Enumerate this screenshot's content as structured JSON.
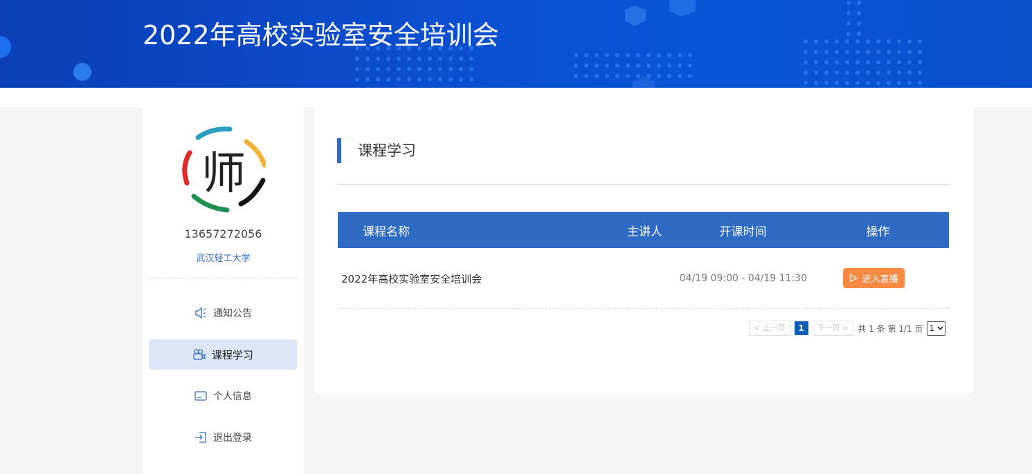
{
  "header": {
    "title": "2022年高校实验室安全培训会",
    "background_color": "#0b4fd0"
  },
  "sidebar": {
    "avatar_glyph": "师",
    "phone": "13657272056",
    "school": "武汉轻工大学",
    "items": [
      {
        "label": "通知公告",
        "icon": "speaker-icon",
        "active": false
      },
      {
        "label": "课程学习",
        "icon": "video-camera-icon",
        "active": true
      },
      {
        "label": "个人信息",
        "icon": "id-card-icon",
        "active": false
      },
      {
        "label": "退出登录",
        "icon": "logout-icon",
        "active": false
      }
    ]
  },
  "main": {
    "section_title": "课程学习",
    "table": {
      "columns": [
        "课程名称",
        "主讲人",
        "开课时间",
        "操作"
      ],
      "rows": [
        {
          "name": "2022年高校实验室安全培训会",
          "speaker": "",
          "time": "04/19 09:00 - 04/19 11:30",
          "action": "进入直播"
        }
      ]
    },
    "pager": {
      "prev": "< 上一页",
      "current": "1",
      "next": "下一页 >",
      "summary": "共 1 条 第 1/1 页",
      "page_select": "1"
    }
  },
  "colors": {
    "accent": "#2f6bc4",
    "action_button": "#f98a45",
    "active_menu_bg": "#dce6f6"
  }
}
